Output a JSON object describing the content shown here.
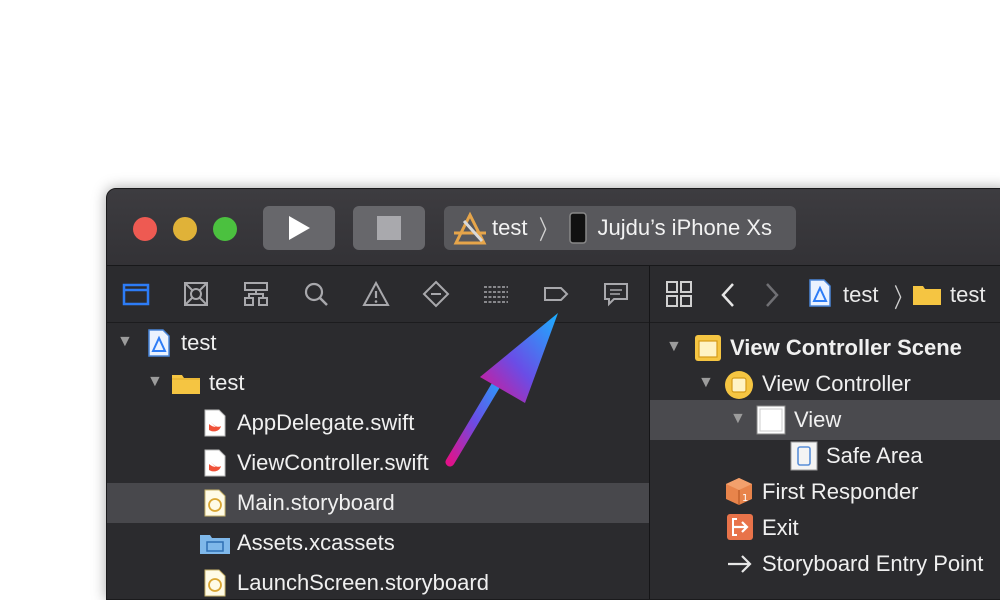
{
  "toolbar": {
    "scheme": {
      "project": "test",
      "device": "Jujdu’s iPhone Xs"
    }
  },
  "navigator": {
    "tree": [
      {
        "label": "test",
        "depth": 0,
        "kind": "project",
        "expanded": true
      },
      {
        "label": "test",
        "depth": 1,
        "kind": "folder",
        "expanded": true
      },
      {
        "label": "AppDelegate.swift",
        "depth": 2,
        "kind": "swift"
      },
      {
        "label": "ViewController.swift",
        "depth": 2,
        "kind": "swift"
      },
      {
        "label": "Main.storyboard",
        "depth": 2,
        "kind": "storyboard",
        "selected": true
      },
      {
        "label": "Assets.xcassets",
        "depth": 2,
        "kind": "assets"
      },
      {
        "label": "LaunchScreen.storyboard",
        "depth": 2,
        "kind": "storyboard"
      }
    ]
  },
  "editor": {
    "jumpbar": {
      "project": "test",
      "folder": "test"
    },
    "outline": [
      {
        "label": "View Controller Scene",
        "bold": true
      },
      {
        "label": "View Controller"
      },
      {
        "label": "View",
        "selected": true
      },
      {
        "label": "Safe Area"
      },
      {
        "label": "First Responder"
      },
      {
        "label": "Exit"
      },
      {
        "label": "Storyboard Entry Point"
      }
    ]
  },
  "colors": {
    "close": "#ee5a52",
    "minimize": "#e0b238",
    "zoom": "#4bc13f",
    "accent": "#2d7cf6",
    "folder": "#f5c542"
  }
}
